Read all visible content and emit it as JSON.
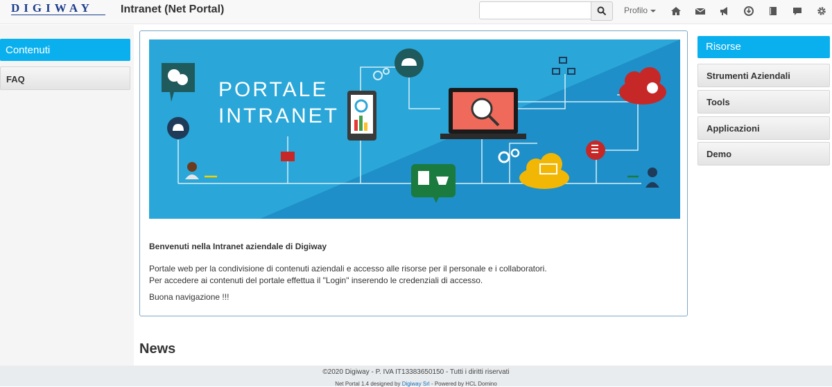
{
  "header": {
    "logo": "DIGIWAY",
    "title": "Intranet (Net Portal)",
    "search": {
      "placeholder": "",
      "value": ""
    },
    "profile": "Profilo"
  },
  "nav_icons": [
    "home-icon",
    "mail-icon",
    "megaphone-icon",
    "download-icon",
    "book-icon",
    "comment-icon",
    "gear-icon"
  ],
  "sidebar_left": {
    "active": "Contenuti",
    "items": [
      "FAQ"
    ]
  },
  "banner": {
    "line1": "PORTALE",
    "line2": "INTRANET"
  },
  "welcome": {
    "title": "Benvenuti nella Intranet aziendale di Digiway",
    "line1": "Portale web per la condivisione di contenuti aziendali e accesso alle risorse per il personale e i collaboratori.",
    "line2": "Per accedere ai contenuti del portale effettua il \"Login\" inserendo le credenziali di accesso.",
    "line3": "Buona navigazione !!!"
  },
  "news_heading": "News",
  "sidebar_right": {
    "title": "Risorse",
    "items": [
      "Strumenti Aziendali",
      "Tools",
      "Applicazioni",
      "Demo"
    ]
  },
  "footer": {
    "copyright": "©2020 Digiway - P. IVA IT13383650150 - Tutti i diritti riservati",
    "credits_prefix": "Net Portal 1.4 designed by ",
    "credits_link": "Digiway Srl",
    "credits_suffix": " - Powered by HCL Domino"
  },
  "colors": {
    "accent": "#0ab0ee",
    "banner_bg": "#2aa7d8",
    "logo": "#1c3d8c"
  }
}
